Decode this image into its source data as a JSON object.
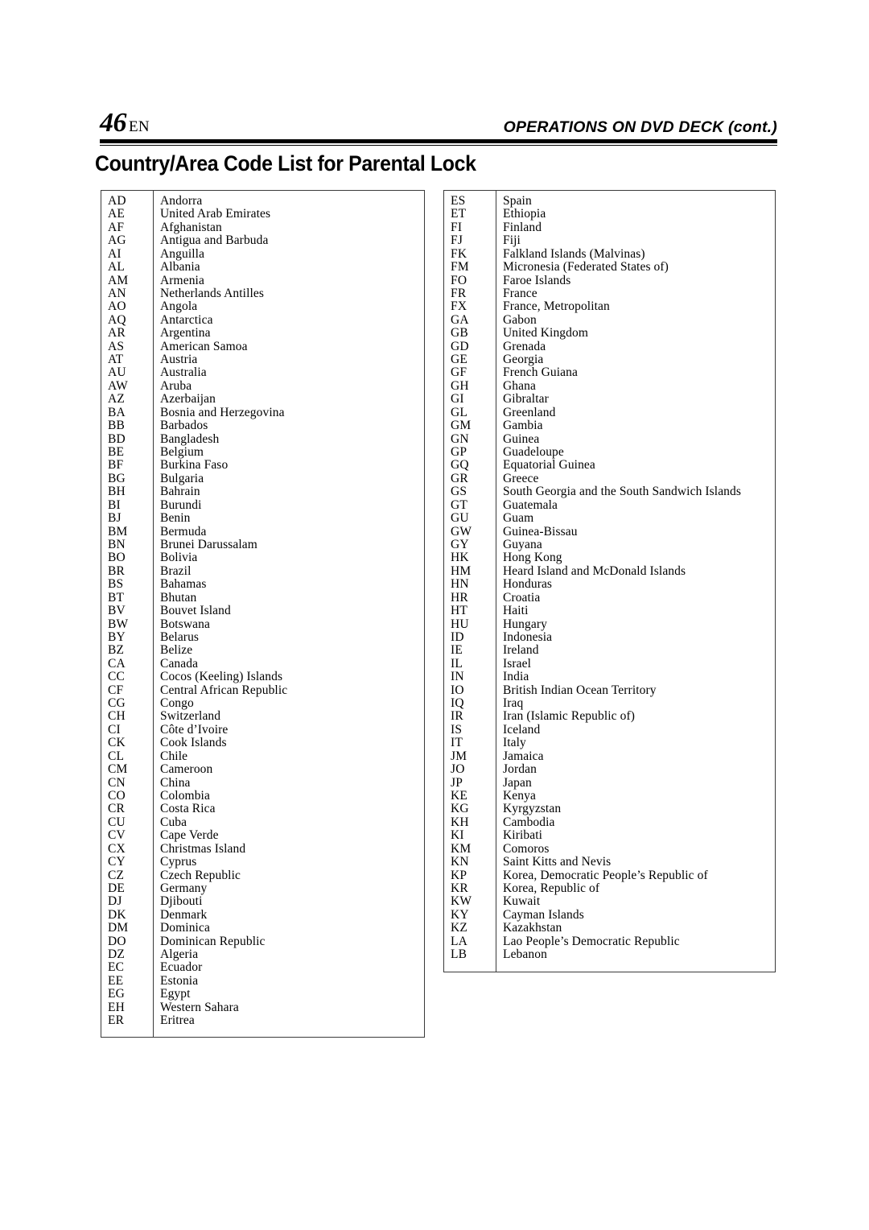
{
  "header": {
    "page_number": "46",
    "language": "EN",
    "running_head": "OPERATIONS ON DVD DECK (cont.)"
  },
  "section": {
    "title": "Country/Area Code List for Parental Lock"
  },
  "columns": {
    "left": [
      {
        "code": "AD",
        "name": "Andorra"
      },
      {
        "code": "AE",
        "name": "United Arab Emirates"
      },
      {
        "code": "AF",
        "name": "Afghanistan"
      },
      {
        "code": "AG",
        "name": "Antigua and Barbuda"
      },
      {
        "code": "AI",
        "name": "Anguilla"
      },
      {
        "code": "AL",
        "name": "Albania"
      },
      {
        "code": "AM",
        "name": "Armenia"
      },
      {
        "code": "AN",
        "name": "Netherlands Antilles"
      },
      {
        "code": "AO",
        "name": "Angola"
      },
      {
        "code": "AQ",
        "name": "Antarctica"
      },
      {
        "code": "AR",
        "name": "Argentina"
      },
      {
        "code": "AS",
        "name": "American Samoa"
      },
      {
        "code": "AT",
        "name": "Austria"
      },
      {
        "code": "AU",
        "name": "Australia"
      },
      {
        "code": "AW",
        "name": "Aruba"
      },
      {
        "code": "AZ",
        "name": "Azerbaijan"
      },
      {
        "code": "BA",
        "name": "Bosnia and Herzegovina"
      },
      {
        "code": "BB",
        "name": "Barbados"
      },
      {
        "code": "BD",
        "name": "Bangladesh"
      },
      {
        "code": "BE",
        "name": "Belgium"
      },
      {
        "code": "BF",
        "name": "Burkina Faso"
      },
      {
        "code": "BG",
        "name": "Bulgaria"
      },
      {
        "code": "BH",
        "name": "Bahrain"
      },
      {
        "code": "BI",
        "name": "Burundi"
      },
      {
        "code": "BJ",
        "name": "Benin"
      },
      {
        "code": "BM",
        "name": "Bermuda"
      },
      {
        "code": "BN",
        "name": "Brunei Darussalam"
      },
      {
        "code": "BO",
        "name": "Bolivia"
      },
      {
        "code": "BR",
        "name": "Brazil"
      },
      {
        "code": "BS",
        "name": "Bahamas"
      },
      {
        "code": "BT",
        "name": "Bhutan"
      },
      {
        "code": "BV",
        "name": "Bouvet Island"
      },
      {
        "code": "BW",
        "name": "Botswana"
      },
      {
        "code": "BY",
        "name": "Belarus"
      },
      {
        "code": "BZ",
        "name": "Belize"
      },
      {
        "code": "CA",
        "name": "Canada"
      },
      {
        "code": "CC",
        "name": "Cocos (Keeling) Islands"
      },
      {
        "code": "CF",
        "name": "Central African Republic"
      },
      {
        "code": "CG",
        "name": "Congo"
      },
      {
        "code": "CH",
        "name": "Switzerland"
      },
      {
        "code": "CI",
        "name": "Côte d’Ivoire"
      },
      {
        "code": "CK",
        "name": "Cook Islands"
      },
      {
        "code": "CL",
        "name": "Chile"
      },
      {
        "code": "CM",
        "name": "Cameroon"
      },
      {
        "code": "CN",
        "name": "China"
      },
      {
        "code": "CO",
        "name": "Colombia"
      },
      {
        "code": "CR",
        "name": "Costa Rica"
      },
      {
        "code": "CU",
        "name": "Cuba"
      },
      {
        "code": "CV",
        "name": "Cape Verde"
      },
      {
        "code": "CX",
        "name": "Christmas Island"
      },
      {
        "code": "CY",
        "name": "Cyprus"
      },
      {
        "code": "CZ",
        "name": "Czech Republic"
      },
      {
        "code": "DE",
        "name": "Germany"
      },
      {
        "code": "DJ",
        "name": "Djibouti"
      },
      {
        "code": "DK",
        "name": "Denmark"
      },
      {
        "code": "DM",
        "name": "Dominica"
      },
      {
        "code": "DO",
        "name": "Dominican Republic"
      },
      {
        "code": "DZ",
        "name": "Algeria"
      },
      {
        "code": "EC",
        "name": "Ecuador"
      },
      {
        "code": "EE",
        "name": "Estonia"
      },
      {
        "code": "EG",
        "name": "Egypt"
      },
      {
        "code": "EH",
        "name": "Western Sahara"
      },
      {
        "code": "ER",
        "name": "Eritrea"
      }
    ],
    "right": [
      {
        "code": "ES",
        "name": "Spain"
      },
      {
        "code": "ET",
        "name": "Ethiopia"
      },
      {
        "code": "FI",
        "name": "Finland"
      },
      {
        "code": "FJ",
        "name": "Fiji"
      },
      {
        "code": "FK",
        "name": "Falkland Islands (Malvinas)"
      },
      {
        "code": "FM",
        "name": "Micronesia (Federated States of)"
      },
      {
        "code": "FO",
        "name": "Faroe Islands"
      },
      {
        "code": "FR",
        "name": "France"
      },
      {
        "code": "FX",
        "name": "France, Metropolitan"
      },
      {
        "code": "GA",
        "name": "Gabon"
      },
      {
        "code": "GB",
        "name": "United Kingdom"
      },
      {
        "code": "GD",
        "name": "Grenada"
      },
      {
        "code": "GE",
        "name": "Georgia"
      },
      {
        "code": "GF",
        "name": "French Guiana"
      },
      {
        "code": "GH",
        "name": "Ghana"
      },
      {
        "code": "GI",
        "name": "Gibraltar"
      },
      {
        "code": "GL",
        "name": "Greenland"
      },
      {
        "code": "GM",
        "name": "Gambia"
      },
      {
        "code": "GN",
        "name": "Guinea"
      },
      {
        "code": "GP",
        "name": "Guadeloupe"
      },
      {
        "code": "GQ",
        "name": "Equatorial Guinea"
      },
      {
        "code": "GR",
        "name": "Greece"
      },
      {
        "code": "GS",
        "name": "South Georgia and the South Sandwich Islands"
      },
      {
        "code": "GT",
        "name": "Guatemala"
      },
      {
        "code": "GU",
        "name": "Guam"
      },
      {
        "code": "GW",
        "name": "Guinea-Bissau"
      },
      {
        "code": "GY",
        "name": "Guyana"
      },
      {
        "code": "HK",
        "name": "Hong Kong"
      },
      {
        "code": "HM",
        "name": "Heard Island and McDonald Islands"
      },
      {
        "code": "HN",
        "name": "Honduras"
      },
      {
        "code": "HR",
        "name": "Croatia"
      },
      {
        "code": "HT",
        "name": "Haiti"
      },
      {
        "code": "HU",
        "name": "Hungary"
      },
      {
        "code": "ID",
        "name": "Indonesia"
      },
      {
        "code": "IE",
        "name": "Ireland"
      },
      {
        "code": "IL",
        "name": "Israel"
      },
      {
        "code": "IN",
        "name": "India"
      },
      {
        "code": "IO",
        "name": "British Indian Ocean Territory"
      },
      {
        "code": "IQ",
        "name": "Iraq"
      },
      {
        "code": "IR",
        "name": "Iran (Islamic Republic of)"
      },
      {
        "code": "IS",
        "name": "Iceland"
      },
      {
        "code": "IT",
        "name": "Italy"
      },
      {
        "code": "JM",
        "name": "Jamaica"
      },
      {
        "code": "JO",
        "name": "Jordan"
      },
      {
        "code": "JP",
        "name": "Japan"
      },
      {
        "code": "KE",
        "name": "Kenya"
      },
      {
        "code": "KG",
        "name": "Kyrgyzstan"
      },
      {
        "code": "KH",
        "name": "Cambodia"
      },
      {
        "code": "KI",
        "name": "Kiribati"
      },
      {
        "code": "KM",
        "name": "Comoros"
      },
      {
        "code": "KN",
        "name": "Saint Kitts and Nevis"
      },
      {
        "code": "KP",
        "name": "Korea, Democratic People’s Republic of"
      },
      {
        "code": "KR",
        "name": "Korea, Republic of"
      },
      {
        "code": "KW",
        "name": "Kuwait"
      },
      {
        "code": "KY",
        "name": "Cayman Islands"
      },
      {
        "code": "KZ",
        "name": "Kazakhstan"
      },
      {
        "code": "LA",
        "name": "Lao People’s Democratic Republic"
      },
      {
        "code": "LB",
        "name": "Lebanon"
      }
    ]
  }
}
